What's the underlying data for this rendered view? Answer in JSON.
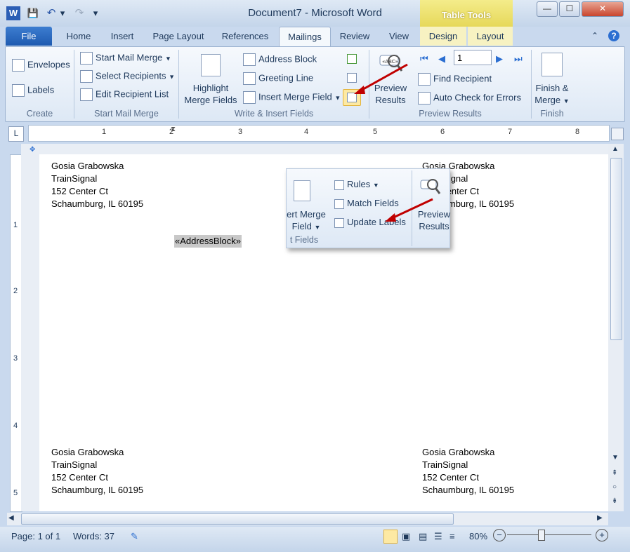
{
  "window": {
    "title": "Document7 - Microsoft Word",
    "context_tab_group": "Table Tools"
  },
  "window_controls": {
    "minimize": "—",
    "maximize": "☐",
    "close": "✕"
  },
  "qat": {
    "app_icon": "W",
    "save": "💾",
    "undo": "↶",
    "undo_dropdown": "▾",
    "redo": "↷",
    "customize": "▾"
  },
  "tabs": [
    {
      "label": "File"
    },
    {
      "label": "Home"
    },
    {
      "label": "Insert"
    },
    {
      "label": "Page Layout"
    },
    {
      "label": "References"
    },
    {
      "label": "Mailings"
    },
    {
      "label": "Review"
    },
    {
      "label": "View"
    },
    {
      "label": "Design"
    },
    {
      "label": "Layout"
    }
  ],
  "ribbon": {
    "create": {
      "label": "Create",
      "envelopes": "Envelopes",
      "labels": "Labels"
    },
    "start_mail_merge": {
      "label": "Start Mail Merge",
      "start": "Start Mail Merge",
      "select": "Select Recipients",
      "edit": "Edit Recipient List"
    },
    "write_insert": {
      "label": "Write & Insert Fields",
      "highlight_1": "Highlight",
      "highlight_2": "Merge Fields",
      "address_block": "Address Block",
      "greeting_line": "Greeting Line",
      "insert_merge_field": "Insert Merge Field"
    },
    "preview": {
      "label": "Preview Results",
      "preview_1": "Preview",
      "preview_2": "Results",
      "record": "1",
      "find_recipient": "Find Recipient",
      "auto_check": "Auto Check for Errors"
    },
    "finish": {
      "label": "Finish",
      "finish_1": "Finish &",
      "finish_2": "Merge"
    }
  },
  "callout": {
    "rules": "Rules",
    "match_fields": "Match Fields",
    "update_labels": "Update Labels",
    "insert_1": "ert Merge",
    "insert_2": "Field",
    "group_frag": "t Fields",
    "preview_1": "Preview",
    "preview_2": "Results"
  },
  "ruler": {
    "h_ticks": [
      "1",
      "2",
      "3",
      "4",
      "5",
      "6",
      "7",
      "8"
    ],
    "v_ticks": [
      "1",
      "2",
      "3",
      "4",
      "5"
    ]
  },
  "document": {
    "labels": [
      {
        "name": "Gosia Grabowska",
        "company": "TrainSignal",
        "street": "152 Center Ct",
        "city": "Schaumburg, IL 60195"
      },
      {
        "name": "Gosia Grabowska",
        "company": "TrainSignal",
        "street": "152 Center Ct",
        "city": "Schaumburg, IL 60195"
      },
      {
        "name": "Gosia Grabowska",
        "company": "TrainSignal",
        "street": "152 Center Ct",
        "city": "Schaumburg, IL 60195"
      },
      {
        "name": "Gosia Grabowska",
        "company": "TrainSignal",
        "street": "152 Center Ct",
        "city": "Schaumburg, IL 60195"
      }
    ],
    "field": "«AddressBlock»"
  },
  "status": {
    "page": "Page: 1 of 1",
    "words": "Words: 37",
    "zoom": "80%"
  },
  "colors": {
    "accent": "#2b579a",
    "arrow": "#c00000"
  }
}
